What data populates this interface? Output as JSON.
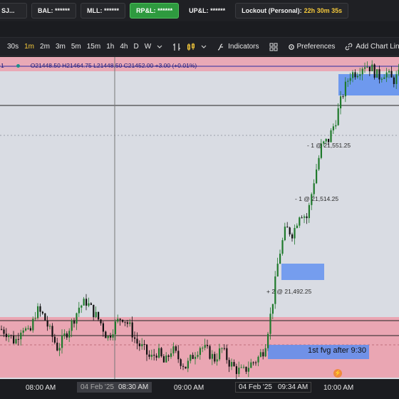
{
  "account": {
    "label": "SJ..."
  },
  "stats": [
    {
      "label": "BAL:",
      "value": "******"
    },
    {
      "label": "MLL:",
      "value": "******"
    },
    {
      "label": "RP&L:",
      "value": "******"
    },
    {
      "label": "UP&L:",
      "value": "******"
    }
  ],
  "lockout": {
    "label": "Lockout (Personal):",
    "value": "22h 30m 35s"
  },
  "toolbar": {
    "intervals": [
      "30s",
      "1m",
      "2m",
      "3m",
      "5m",
      "15m",
      "1h",
      "4h",
      "D",
      "W"
    ],
    "active_interval": "1m",
    "indicators_label": "Indicators",
    "preferences_label": "Preferences",
    "add_chart_link_label": "Add Chart Link"
  },
  "legend": {
    "prefix": "1",
    "ohlc": "O21448.50  H21464.75  L21448.50  C21452.00  +3.00 (+0.01%)"
  },
  "annotations": {
    "sell1": "- 1 @ 21,551.25",
    "sell2": "- 1 @ 21,514.25",
    "buy": "+ 2 @ 21,492.25",
    "fvg": "1st fvg after 9:30"
  },
  "time_axis": {
    "t1": "08:00 AM",
    "crosshair_date": "04 Feb '25",
    "crosshair_time": "08:30 AM",
    "t3": "09:00 AM",
    "cursor_date": "04 Feb '25",
    "cursor_time": "09:34 AM",
    "t5": "10:00 AM"
  },
  "colors": {
    "chart_bg": "#d9dce3",
    "up_candle": "#1f7a2c",
    "down_candle": "#111111",
    "zone_pink": "#eaa6b3",
    "zone_blue": "#5b8df0",
    "accent_yellow": "#f5c93b",
    "button_green": "#2e9a3f"
  },
  "chart_data": {
    "type": "candlestick",
    "instrument_hint": "NQ futures 1m",
    "y_range": [
      21380,
      21620
    ],
    "close_path": [
      [
        0,
        21415
      ],
      [
        10,
        21412
      ],
      [
        20,
        21405
      ],
      [
        30,
        21418
      ],
      [
        40,
        21410
      ],
      [
        50,
        21430
      ],
      [
        60,
        21425
      ],
      [
        70,
        21412
      ],
      [
        80,
        21400
      ],
      [
        90,
        21410
      ],
      [
        100,
        21420
      ],
      [
        110,
        21432
      ],
      [
        120,
        21436
      ],
      [
        130,
        21428
      ],
      [
        140,
        21420
      ],
      [
        150,
        21408
      ],
      [
        160,
        21418
      ],
      [
        170,
        21425
      ],
      [
        180,
        21418
      ],
      [
        190,
        21405
      ],
      [
        200,
        21400
      ],
      [
        210,
        21392
      ],
      [
        220,
        21398
      ],
      [
        230,
        21388
      ],
      [
        240,
        21400
      ],
      [
        250,
        21392
      ],
      [
        260,
        21386
      ],
      [
        270,
        21395
      ],
      [
        280,
        21402
      ],
      [
        290,
        21398
      ],
      [
        300,
        21392
      ],
      [
        310,
        21400
      ],
      [
        320,
        21390
      ],
      [
        330,
        21384
      ],
      [
        340,
        21382
      ],
      [
        350,
        21388
      ],
      [
        360,
        21392
      ],
      [
        370,
        21400
      ],
      [
        380,
        21430
      ],
      [
        390,
        21470
      ],
      [
        400,
        21492
      ],
      [
        410,
        21488
      ],
      [
        420,
        21505
      ],
      [
        430,
        21500
      ],
      [
        440,
        21530
      ],
      [
        450,
        21555
      ],
      [
        460,
        21560
      ],
      [
        470,
        21575
      ],
      [
        480,
        21595
      ],
      [
        490,
        21610
      ],
      [
        500,
        21612
      ],
      [
        510,
        21618
      ],
      [
        520,
        21615
      ],
      [
        530,
        21608
      ],
      [
        540,
        21612
      ],
      [
        550,
        21605
      ],
      [
        560,
        21610
      ]
    ]
  }
}
